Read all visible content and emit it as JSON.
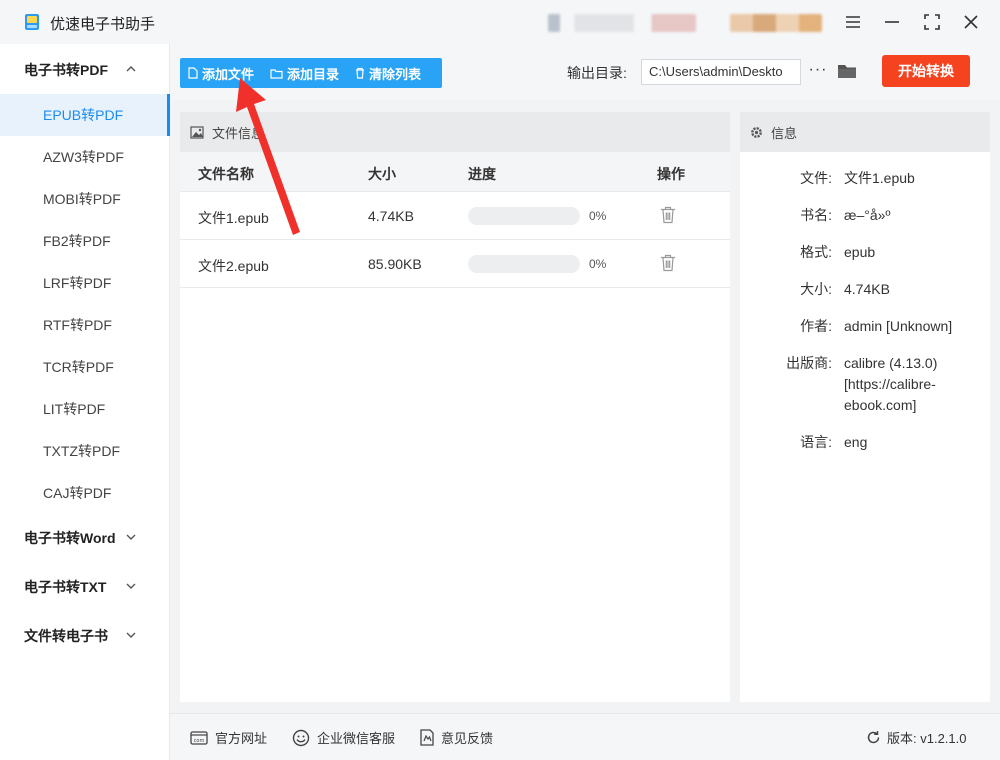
{
  "app": {
    "title": "优速电子书助手",
    "colors": {
      "accent": "#29a3f5",
      "start": "#f5431f",
      "active_text": "#1a8cf0"
    }
  },
  "window_controls": {
    "menu_icon": "menu-icon",
    "minimize_icon": "minimize-icon",
    "maximize_icon": "maximize-icon",
    "close_icon": "close-icon"
  },
  "sidebar": {
    "groups": [
      {
        "label": "电子书转PDF",
        "expanded": true
      },
      {
        "label": "电子书转Word",
        "expanded": false
      },
      {
        "label": "电子书转TXT",
        "expanded": false
      },
      {
        "label": "文件转电子书",
        "expanded": false
      }
    ],
    "pdf_items": [
      "EPUB转PDF",
      "AZW3转PDF",
      "MOBI转PDF",
      "FB2转PDF",
      "LRF转PDF",
      "RTF转PDF",
      "TCR转PDF",
      "LIT转PDF",
      "TXTZ转PDF",
      "CAJ转PDF"
    ],
    "active_item": "EPUB转PDF"
  },
  "toolbar": {
    "add_file": "添加文件",
    "add_dir": "添加目录",
    "clear_list": "清除列表",
    "output_label": "输出目录:",
    "output_path": "C:\\Users\\admin\\Deskto",
    "more": "···",
    "start": "开始转换"
  },
  "file_panel": {
    "title": "文件信息",
    "columns": [
      "文件名称",
      "大小",
      "进度",
      "操作"
    ],
    "rows": [
      {
        "name": "文件1.epub",
        "size": "4.74KB",
        "progress": 0,
        "progress_text": "0%"
      },
      {
        "name": "文件2.epub",
        "size": "85.90KB",
        "progress": 0,
        "progress_text": "0%"
      }
    ]
  },
  "info_panel": {
    "title": "信息",
    "fields": [
      {
        "key": "文件:",
        "value": "文件1.epub"
      },
      {
        "key": "书名:",
        "value": "æ–°å»º"
      },
      {
        "key": "格式:",
        "value": "epub"
      },
      {
        "key": "大小:",
        "value": "4.74KB"
      },
      {
        "key": "作者:",
        "value": "admin [Unknown]"
      },
      {
        "key": "出版商:",
        "value": "calibre (4.13.0) [https://calibre-ebook.com]"
      },
      {
        "key": "语言:",
        "value": "eng"
      }
    ]
  },
  "footer": {
    "website": "官方网址",
    "wechat": "企业微信客服",
    "feedback": "意见反馈",
    "version": "版本: v1.2.1.0"
  }
}
